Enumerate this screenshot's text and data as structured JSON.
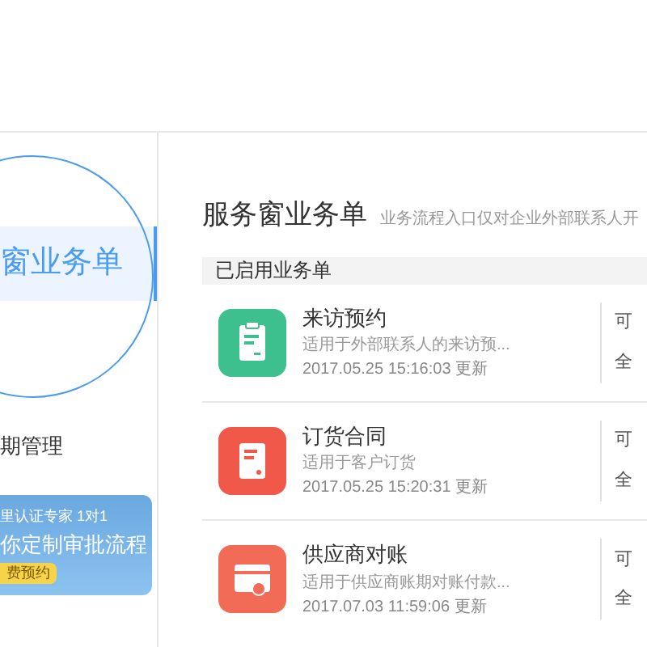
{
  "sidebar": {
    "items": [
      {
        "label": "窗业务单",
        "selected": true
      },
      {
        "label": "期管理",
        "selected": false
      }
    ],
    "banner": {
      "line_1": "里认证专家 1对1",
      "line_2": "你定制审批流程",
      "button": "费预约"
    }
  },
  "main": {
    "title": "服务窗业务单",
    "subtitle": "业务流程入口仅对企业外部联系人开",
    "section": "已启用业务单",
    "forms": [
      {
        "kind": "clipboard",
        "color": "#3ec08e",
        "name": "来访预约",
        "description": "适用于外部联系人的来访预...",
        "updated": "2017.05.25 15:16:03 更新",
        "column_2_line_1": "可",
        "column_2_line_2": "全"
      },
      {
        "kind": "document",
        "color": "#f0584a",
        "name": "订货合同",
        "description": "适用于客户订货",
        "updated": "2017.05.25 15:20:31 更新",
        "column_2_line_1": "可",
        "column_2_line_2": "全"
      },
      {
        "kind": "card",
        "color": "#f26b57",
        "name": "供应商对账",
        "description": "适用于供应商账期对账付款...",
        "updated": "2017.07.03 11:59:06 更新",
        "column_2_line_1": "可",
        "column_2_line_2": "全"
      }
    ]
  }
}
